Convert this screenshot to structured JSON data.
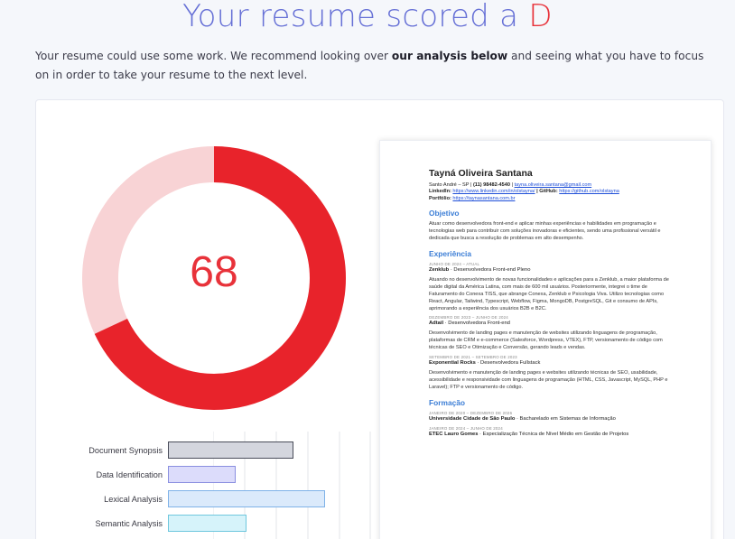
{
  "header": {
    "title_prefix": "Your resume scored a ",
    "grade": "D"
  },
  "intro": {
    "text_before": "Your resume could use some work. We recommend looking over ",
    "bold": "our analysis below",
    "text_after": " and seeing what you have to focus on in order to take your resume to the next level."
  },
  "score": {
    "value": "68",
    "fraction": 0.68,
    "colors": {
      "filled": "#e8232b",
      "remaining": "#f8d3d5"
    }
  },
  "analysis_bars": [
    {
      "label": "Document Synopsis",
      "fill": "#d4d6de",
      "border": "#4a4d5a",
      "level": 0.8
    },
    {
      "label": "Data Identification",
      "fill": "#dcdcfb",
      "border": "#8a8fe0",
      "level": 0.43
    },
    {
      "label": "Lexical Analysis",
      "fill": "#dbeafb",
      "border": "#7fb2e8",
      "level": 1.0
    },
    {
      "label": "Semantic Analysis",
      "fill": "#d6f3fa",
      "border": "#6fc7dd",
      "level": 0.5
    }
  ],
  "resume": {
    "name": "Tayná Oliveira Santana",
    "contact_line1_prefix": "Santo André – SP | ",
    "phone": "(11) 98482-4540",
    "contact_sep": " | ",
    "email": "tayna.oliveira.santana@gmail.com",
    "linkedin_label": "LinkedIn: ",
    "linkedin_url": "https://www.linkedin.com/in/olstayna/",
    "github_label": " | GitHub: ",
    "github_url": "https://github.com/olstayna",
    "portfolio_label": "Portfólio: ",
    "portfolio_url": "https://taynasantana.com.br",
    "objective_title": "Objetivo",
    "objective_text": "Atuar como desenvolvedora front-end e aplicar minhas experiências e habilidades em programação e tecnologias web para contribuir com soluções inovadoras e eficientes, sendo uma profissional versátil e dedicada que busca a resolução de problemas em alto desempenho.",
    "experience_title": "Experiência",
    "jobs": [
      {
        "date": "JUNHO DE 2024 – ATUAL",
        "company": "Zenklub",
        "role": " · Desenvolvedora Front-end Pleno",
        "description": "Atuando no desenvolvimento de novas funcionalidades e aplicações para a Zenklub, a maior plataforma de saúde digital da América Latina, com mais de 600 mil usuários. Posteriormente, integrei o time de Faturamento do Conexa TISS, que abrange Conexa, Zenklub e Psicologia Viva. Utilizo tecnologias como React, Angular, Tailwind, Typescript, Webflow, Figma, MongoDB, PostgreSQL, Git e consumo de APIs, aprimorando a experiência dos usuários B2B e B2C."
      },
      {
        "date": "DEZEMBRO DE 2023 – JUNHO DE 2024",
        "company": "Adtail",
        "role": " · Desenvolvedora Front-end",
        "description": "Desenvolvimento de landing pages e manutenção de websites utilizando linguagens de programação, plataformas de CRM e e-commerce (Salesforce, Wordpress, VTEX), FTP, versionamento de código com técnicas de SEO e Otimização e Conversão, gerando leads e vendas."
      },
      {
        "date": "SETEMBRO DE 2021 – SETEMBRO DE 2023",
        "company": "Exponential Rocks",
        "role": " · Desenvolvedora Fullstack",
        "description": "Desenvolvimento e manutenção de landing pages e websites utilizando técnicas de SEO, usabilidade, acessibilidade e responsividade com linguagens de programação (HTML, CSS, Javascript, MySQL, PHP e Laravel); FTP e versionamento de código."
      }
    ],
    "education_title": "Formação",
    "education": [
      {
        "date": "JANEIRO DE 2020 – DEZEMBRO DE 2026",
        "school": "Universidade Cidade de São Paulo",
        "course": " · Bacharelado em Sistemas de Informação"
      },
      {
        "date": "JANEIRO DE 2024 – JUNHO DE 2024",
        "school": "ETEC Lauro Gomes",
        "course": " · Especialização Técnica de Nível Médio em Gestão de Projetos"
      }
    ]
  }
}
